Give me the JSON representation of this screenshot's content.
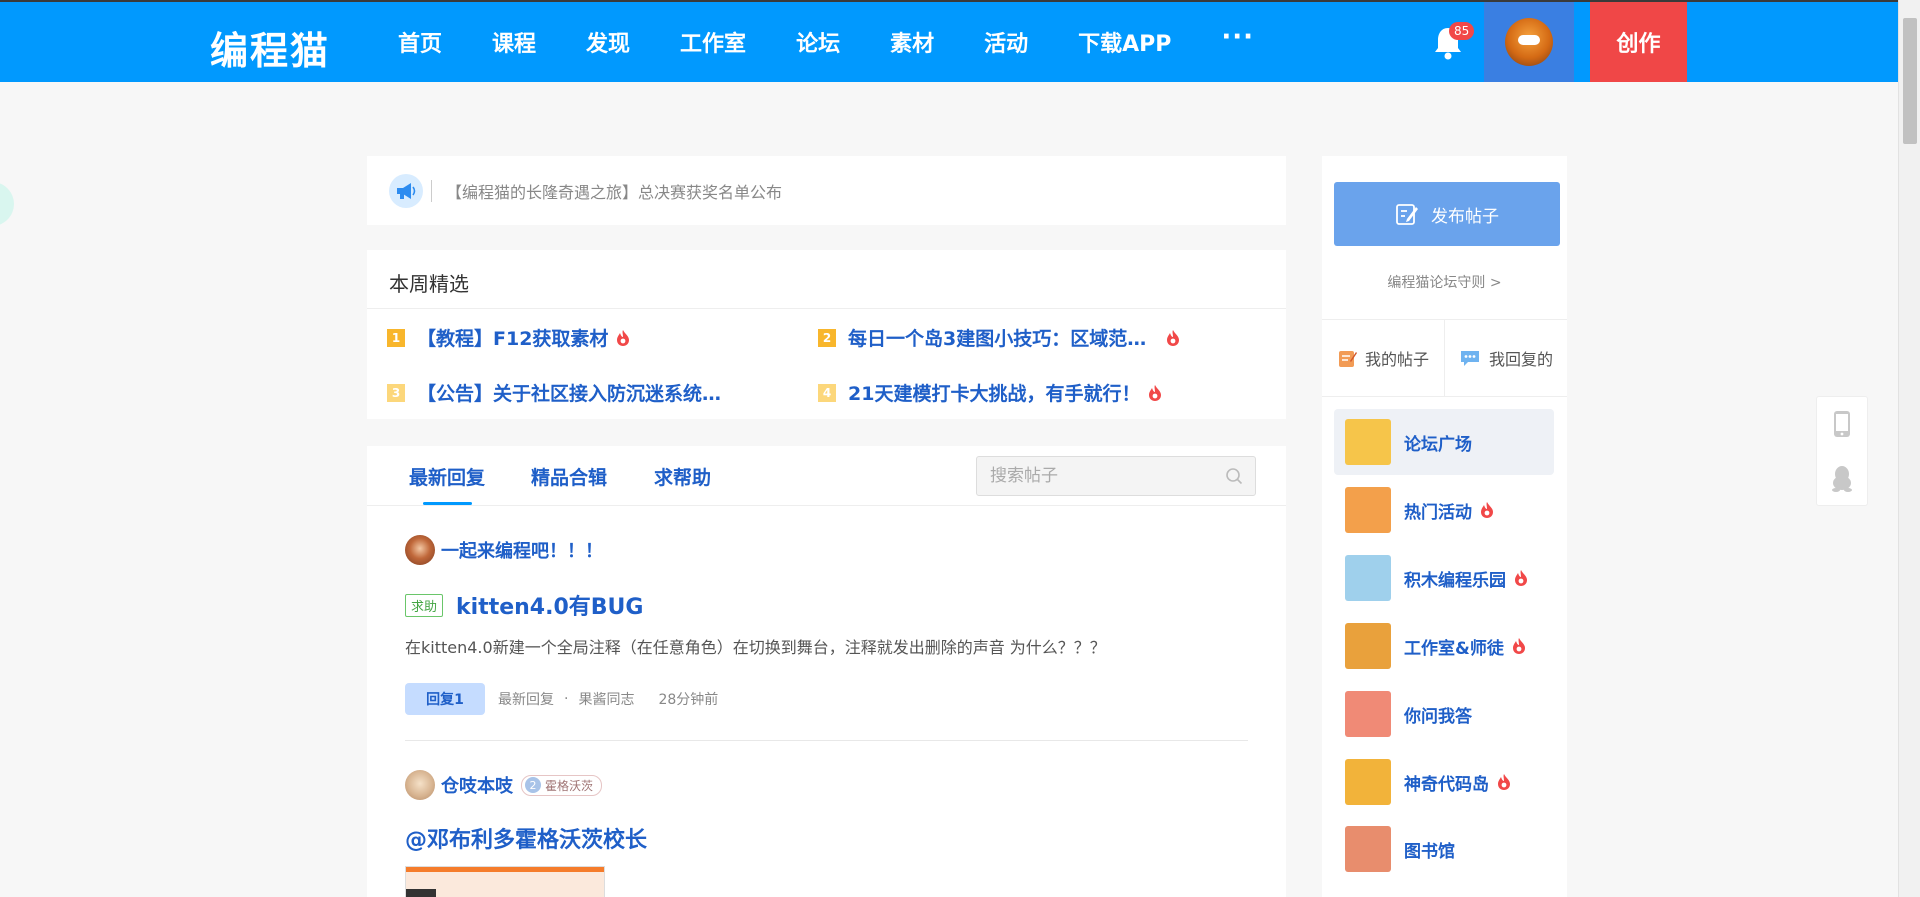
{
  "header": {
    "logo": "编程猫",
    "nav": [
      "首页",
      "课程",
      "发现",
      "工作室",
      "论坛",
      "素材",
      "活动",
      "下载APP"
    ],
    "more": "···",
    "notification_count": "85",
    "create_label": "创作"
  },
  "notice": {
    "text": "【编程猫的长隆奇遇之旅】总决赛获奖名单公布"
  },
  "weekly": {
    "title": "本周精选",
    "items": [
      {
        "rank": "1",
        "title": "【教程】F12获取素材",
        "hot": true
      },
      {
        "rank": "2",
        "title": "每日一个岛3建图小技巧：区域范…",
        "hot": true
      },
      {
        "rank": "3",
        "title": "【公告】关于社区接入防沉迷系统…",
        "hot": false
      },
      {
        "rank": "4",
        "title": "21天建模打卡大挑战，有手就行！",
        "hot": true
      }
    ]
  },
  "feed": {
    "tabs": [
      "最新回复",
      "精品合辑",
      "求帮助"
    ],
    "active_tab": "最新回复",
    "search_placeholder": "搜索帖子",
    "posts": [
      {
        "author": "一起来编程吧！！！",
        "tag": "求助",
        "title": "kitten4.0有BUG",
        "body": "在kitten4.0新建一个全局注释（在任意角色）在切换到舞台，注释就发出删除的声音  为什么？？？",
        "reply_label": "回复1",
        "latest_reply": "最新回复",
        "dot": "·",
        "replier": "果酱同志",
        "time": "28分钟前"
      },
      {
        "author": "仓吱本吱",
        "level": "2",
        "badge": "霍格沃茨",
        "title": "@邓布利多霍格沃茨校长"
      }
    ]
  },
  "sidebar": {
    "publish_label": "发布帖子",
    "rules_link": "编程猫论坛守则 >",
    "my_posts": "我的帖子",
    "my_replies": "我回复的",
    "boards": [
      {
        "name": "论坛广场",
        "hot": false,
        "color": "#f6c54a"
      },
      {
        "name": "热门活动",
        "hot": true,
        "color": "#f3a04b"
      },
      {
        "name": "积木编程乐园",
        "hot": true,
        "color": "#9fd0ec"
      },
      {
        "name": "工作室&师徒",
        "hot": true,
        "color": "#e9a13c"
      },
      {
        "name": "你问我答",
        "hot": false,
        "color": "#f08a76"
      },
      {
        "name": "神奇代码岛",
        "hot": true,
        "color": "#f2b33a"
      },
      {
        "name": "图书馆",
        "hot": false,
        "color": "#e88d6d"
      }
    ]
  },
  "colors": {
    "brand_blue": "#0199fe",
    "create_red": "#f04747",
    "link_blue": "#1f5fc8",
    "hot_red": "#f14848"
  }
}
